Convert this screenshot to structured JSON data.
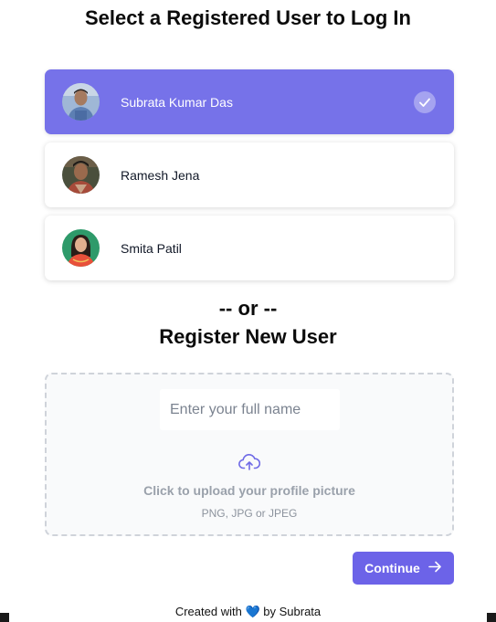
{
  "page": {
    "title": "Select a Registered User to Log In"
  },
  "users": [
    {
      "name": "Subrata Kumar Das",
      "selected": true,
      "avatar": "user-photo"
    },
    {
      "name": "Ramesh Jena",
      "selected": false,
      "avatar": "user-photo"
    },
    {
      "name": "Smita Patil",
      "selected": false,
      "avatar": "user-photo"
    }
  ],
  "divider": "-- or --",
  "register": {
    "title": "Register New User",
    "name_placeholder": "Enter your full name",
    "name_value": "",
    "upload_icon": "cloud-upload-icon",
    "upload_label": "Click to upload your profile picture",
    "upload_hint": "PNG, JPG or JPEG"
  },
  "actions": {
    "continue_label": "Continue",
    "continue_icon": "arrow-right-icon"
  },
  "footer": {
    "prefix": "Created with",
    "heart": "💙",
    "suffix": "by Subrata"
  },
  "colors": {
    "accent": "#6c63e8",
    "selected_card": "#7672e9",
    "dashed_border": "#cfd3da"
  }
}
